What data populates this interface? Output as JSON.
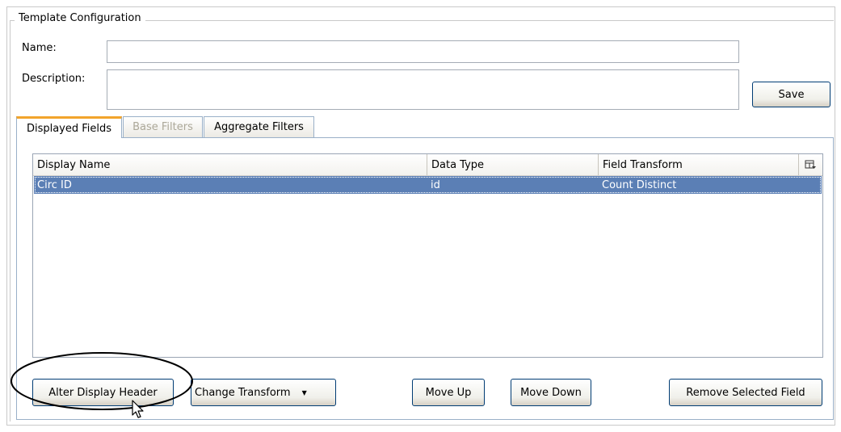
{
  "config": {
    "legend": "Template Configuration",
    "name_label": "Name:",
    "name_value": "",
    "description_label": "Description:",
    "description_value": "",
    "save_label": "Save"
  },
  "tabs": [
    {
      "label": "Displayed Fields",
      "active": true,
      "disabled": false
    },
    {
      "label": "Base Filters",
      "active": false,
      "disabled": true
    },
    {
      "label": "Aggregate Filters",
      "active": false,
      "disabled": false
    }
  ],
  "grid": {
    "columns": [
      "Display Name",
      "Data Type",
      "Field Transform"
    ],
    "column_menu_icon": "column-chooser-icon",
    "rows": [
      {
        "display_name": "Circ ID",
        "data_type": "id",
        "field_transform": "Count Distinct",
        "selected": true
      }
    ],
    "selection_color": "#5b7fb5"
  },
  "buttons": {
    "alter_header": "Alter Display Header",
    "change_transform": "Change Transform",
    "change_transform_arrow": "▼",
    "move_up": "Move Up",
    "move_down": "Move Down",
    "remove_field": "Remove Selected Field"
  },
  "colors": {
    "active_tab_accent": "#f2a42c",
    "button_border": "#003c74"
  }
}
